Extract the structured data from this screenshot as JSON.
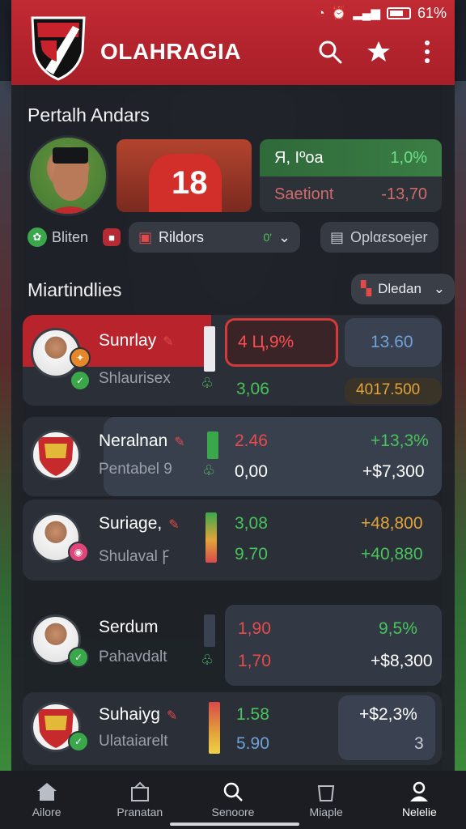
{
  "status": {
    "battery": "61%",
    "wifi_icon": "wifi-icon",
    "alarm_icon": "alarm-icon",
    "signal_icon": "signal-icon"
  },
  "app": {
    "title": "OLAHRAGIA",
    "actions": [
      "search-icon",
      "star-icon",
      "more-vert-icon"
    ],
    "accent": "#b8242d"
  },
  "featured": {
    "title": "Pertalh Andars",
    "jersey_number": "18",
    "stat_top_left": "Я, Iºoa",
    "stat_top_right": "1,0%",
    "stat_bottom_left": "Saetiont",
    "stat_bottom_right": "-13,70"
  },
  "filters": {
    "left_label": "Bliten",
    "select_label": "Rildors",
    "select_suffix": "0'",
    "right_label": "Oplαεsoejer"
  },
  "market": {
    "title": "Miartindlies",
    "sort_label": "Dledan",
    "rows": [
      {
        "name": "Sunrlay",
        "sub": "Shlaurisex",
        "value_a": "4 Ц,9%",
        "value_b": "13.60",
        "value_c": "3,06",
        "value_d": "4017.500"
      },
      {
        "name": "Neralnan",
        "sub": "Pentabel 9",
        "value_a": "2.46",
        "value_b": "+13,3%",
        "value_c": "0,00",
        "value_d": "+$7,300"
      },
      {
        "name": "Suriage,",
        "sub": "Shulaval Ꝼ",
        "value_a": "3,08",
        "value_b": "+48,800",
        "value_c": "9.70",
        "value_d": "+40,880"
      },
      {
        "name": "Serdum",
        "sub": "Pahavdalt",
        "value_a": "1,90",
        "value_b": "9,5%",
        "value_c": "1,70",
        "value_d": "+$8,300"
      },
      {
        "name": "Suhaiyg",
        "sub": "Ulataiarelt",
        "value_a": "1.58",
        "value_b": "+$2,3%",
        "value_c": "5.90",
        "value_d": "3"
      }
    ]
  },
  "nav": [
    {
      "label": "Ailore",
      "icon": "home-icon"
    },
    {
      "label": "Pranatan",
      "icon": "store-icon"
    },
    {
      "label": "Senoore",
      "icon": "search-icon"
    },
    {
      "label": "Miaple",
      "icon": "bucket-icon"
    },
    {
      "label": "Nelelie",
      "icon": "profile-icon"
    }
  ],
  "colors": {
    "green": "#49c35b",
    "red": "#d94a4a",
    "orange": "#e2a43a",
    "panel": "#1e2128"
  }
}
